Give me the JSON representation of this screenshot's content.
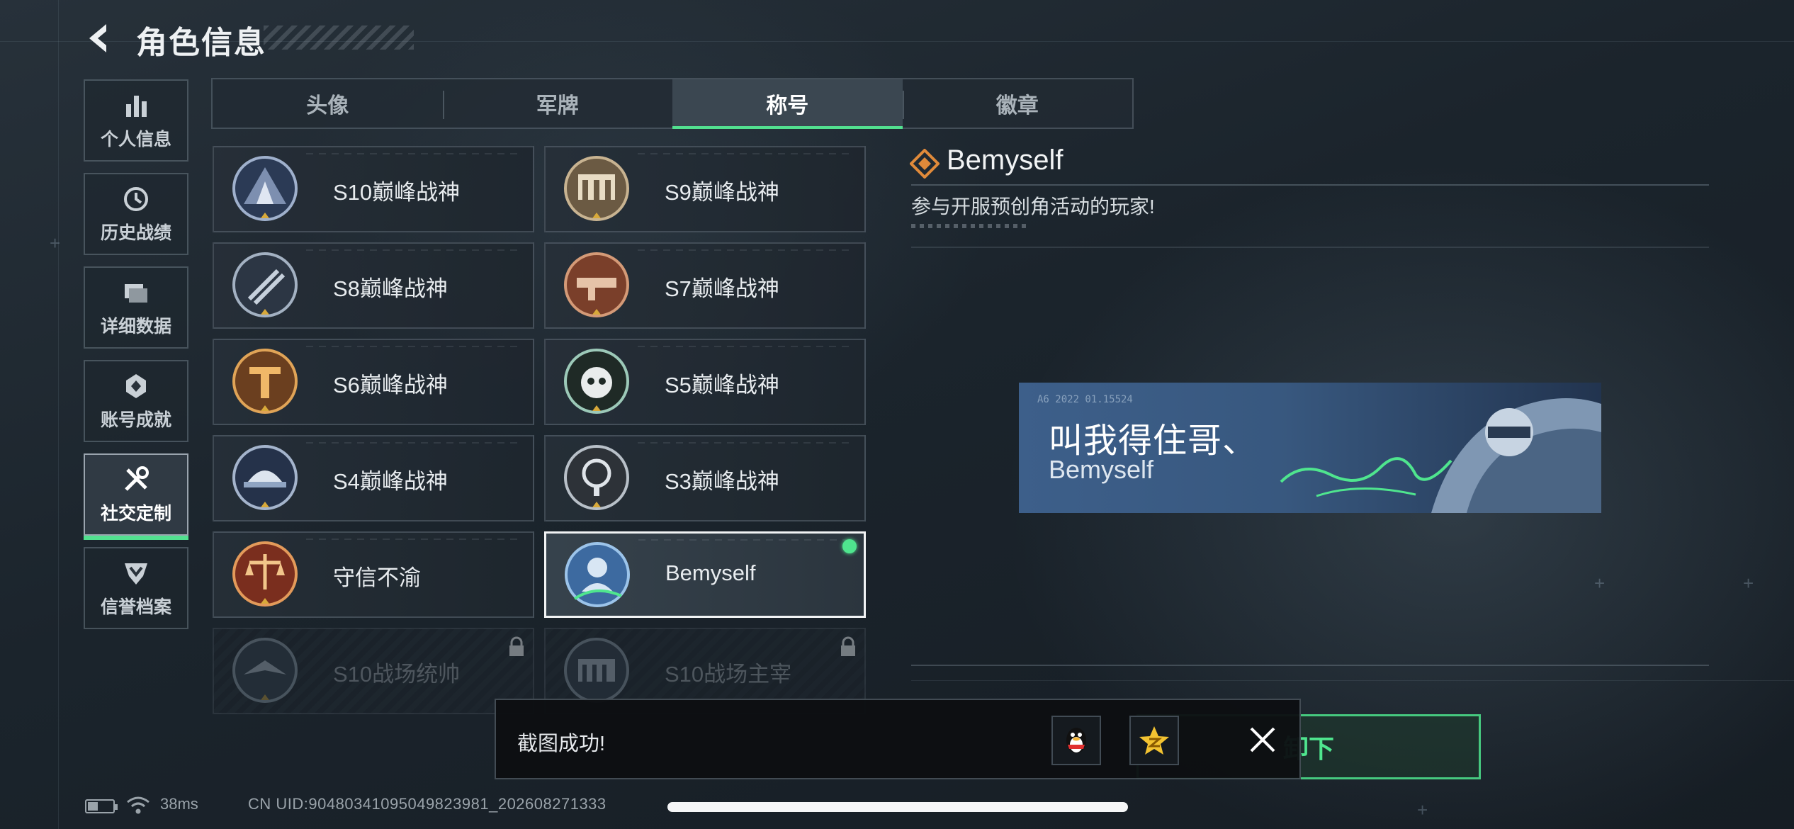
{
  "header": {
    "title": "角色信息"
  },
  "sidebar": {
    "items": [
      {
        "label": "个人信息",
        "icon": "bar-chart-icon",
        "active": false
      },
      {
        "label": "历史战绩",
        "icon": "clock-history-icon",
        "active": false
      },
      {
        "label": "详细数据",
        "icon": "folder-stack-icon",
        "active": false
      },
      {
        "label": "账号成就",
        "icon": "achievement-badge-icon",
        "active": false
      },
      {
        "label": "社交定制",
        "icon": "tools-icon",
        "active": true
      },
      {
        "label": "信誉档案",
        "icon": "shield-chevron-icon",
        "active": false
      }
    ]
  },
  "tabs": [
    {
      "label": "头像",
      "active": false
    },
    {
      "label": "军牌",
      "active": false
    },
    {
      "label": "称号",
      "active": true
    },
    {
      "label": "徽章",
      "active": false
    }
  ],
  "titles": [
    {
      "name": "S10巅峰战神",
      "medal": "s10-medal-icon",
      "state": "owned"
    },
    {
      "name": "S9巅峰战神",
      "medal": "s9-medal-icon",
      "state": "owned"
    },
    {
      "name": "S8巅峰战神",
      "medal": "s8-medal-icon",
      "state": "owned"
    },
    {
      "name": "S7巅峰战神",
      "medal": "s7-medal-icon",
      "state": "owned"
    },
    {
      "name": "S6巅峰战神",
      "medal": "s6-medal-icon",
      "state": "owned"
    },
    {
      "name": "S5巅峰战神",
      "medal": "s5-medal-icon",
      "state": "owned"
    },
    {
      "name": "S4巅峰战神",
      "medal": "s4-medal-icon",
      "state": "owned"
    },
    {
      "name": "S3巅峰战神",
      "medal": "s3-medal-icon",
      "state": "owned"
    },
    {
      "name": "守信不渝",
      "medal": "scales-medal-icon",
      "state": "owned"
    },
    {
      "name": "Bemyself",
      "medal": "bemyself-medal-icon",
      "state": "selected-equipped"
    },
    {
      "name": "S10战场统帅",
      "medal": "commander-medal-icon",
      "state": "locked"
    },
    {
      "name": "S10战场主宰",
      "medal": "colosseum-medal-icon",
      "state": "locked"
    }
  ],
  "detail": {
    "title": "Bemyself",
    "description": "参与开服预创角活动的玩家!",
    "nameplate": {
      "main_text": "叫我得住哥、",
      "sub_text": "Bemyself",
      "code_text": "A6 2022 01.15524"
    },
    "equip_button_label": "卸下"
  },
  "toast": {
    "text": "截图成功!",
    "share_targets": [
      "qq-penguin-icon",
      "qzone-star-icon"
    ],
    "close_icon": "close-icon"
  },
  "status": {
    "ping": "38ms",
    "uid": "CN UID:9048034109504982398​1_202608271333"
  },
  "colors": {
    "accent_green": "#52e08f",
    "banner_blue": "#3d5f8a",
    "background": "#1b242c"
  }
}
